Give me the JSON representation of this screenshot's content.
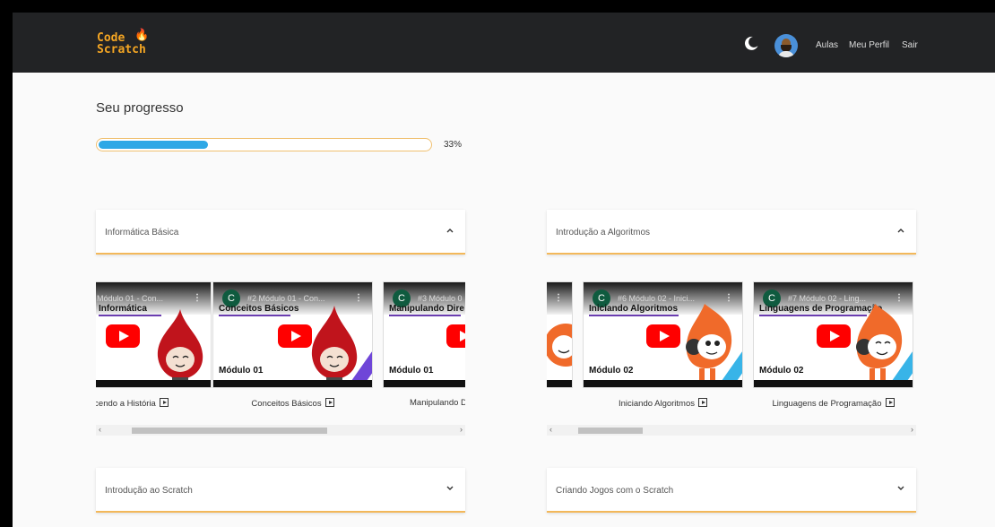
{
  "navbar": {
    "logo_line1": "Code",
    "logo_line2": "Scratch",
    "links": [
      "Aulas",
      "Meu Perfil",
      "Sair"
    ]
  },
  "progress": {
    "title": "Seu progresso",
    "percent_label": "33%",
    "fraction": 0.33,
    "fill_color": "#2ea8e6"
  },
  "modules": [
    {
      "title": "Informática Básica",
      "expanded": true,
      "videos": [
        {
          "title": "Módulo 01 - Con...",
          "heading": "Informática",
          "module": "",
          "caption": "cendo a História"
        },
        {
          "title": "#2 Módulo 01 - Con...",
          "heading": "Conceitos Básicos",
          "module": "Módulo 01",
          "caption": "Conceitos Básicos"
        },
        {
          "title": "#3 Módulo 0",
          "heading": "Manipulando Dire",
          "module": "Módulo 01",
          "caption": "Manipulando D"
        }
      ]
    },
    {
      "title": "Introdução a Algoritmos",
      "expanded": true,
      "videos": [
        {
          "title": "",
          "heading": "",
          "module": "",
          "caption": ""
        },
        {
          "title": "#6 Módulo 02 - Inici...",
          "heading": "Iniciando Algoritmos",
          "module": "Módulo 02",
          "caption": "Iniciando Algoritmos"
        },
        {
          "title": "#7 Módulo 02 - Ling...",
          "heading": "Linguagens de Programação",
          "module": "Módulo 02",
          "caption": "Linguagens de Programação"
        }
      ]
    },
    {
      "title": "Introdução ao Scratch",
      "expanded": false
    },
    {
      "title": "Criando Jogos com o Scratch",
      "expanded": false
    }
  ],
  "channel_initial": "C",
  "colors": {
    "navbar": "#222325",
    "accent": "#f3b85a",
    "youtube_red": "#ff0000",
    "stripe_m1": "#6f46d8",
    "stripe_m2": "#38b4e8"
  },
  "icons": [
    "moon-icon",
    "avatar",
    "chevron-up-icon",
    "chevron-down-icon",
    "play-icon",
    "youtube-play-icon"
  ]
}
